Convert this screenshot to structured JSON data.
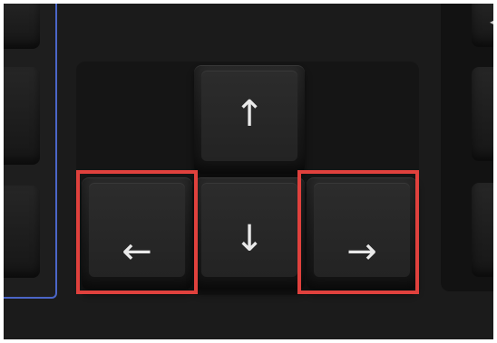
{
  "keyboard": {
    "keys": {
      "up": {
        "symbol": "↑"
      },
      "down": {
        "symbol": "↓"
      },
      "left": {
        "symbol": "←"
      },
      "right": {
        "symbol": "→"
      }
    },
    "highlighted_keys": [
      "left",
      "right"
    ],
    "highlight_color": "#e0413d",
    "left_panel_border_color": "#4b66c8",
    "partial_right_marks": [
      "◂",
      "▪"
    ]
  }
}
